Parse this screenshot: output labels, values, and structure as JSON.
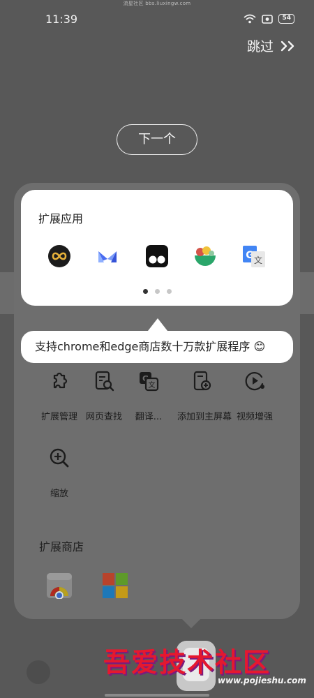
{
  "watermark": {
    "top_text": "流星社区 bbs.liuxingw.com"
  },
  "status_bar": {
    "time": "11:39",
    "battery": "54",
    "icons": [
      "wifi-icon",
      "screen-record-icon",
      "battery-icon"
    ]
  },
  "onboarding": {
    "skip_label": "跳过",
    "skip_icon": "double-chevron-right-icon",
    "next_label": "下一个"
  },
  "card": {
    "title": "扩展应用",
    "apps": [
      {
        "name": "infinity-extension-icon",
        "color": "#c99a1e"
      },
      {
        "name": "m-extension-icon",
        "color": "#5b7cf2"
      },
      {
        "name": "tampermonkey-icon",
        "color": "#111111"
      },
      {
        "name": "food-bowl-extension-icon",
        "color": "#2aa66a"
      },
      {
        "name": "google-translate-icon",
        "color": "#4285f4"
      }
    ],
    "page_dots": {
      "count": 3,
      "active": 0
    }
  },
  "tip": {
    "text": "支持chrome和edge商店数十万款扩展程序 😊"
  },
  "tools": [
    {
      "label": "扩展管理",
      "icon": "puzzle-icon"
    },
    {
      "label": "网页查找",
      "icon": "page-search-icon"
    },
    {
      "label": "翻译...",
      "icon": "translate-icon"
    },
    {
      "label": "添加到主屏幕",
      "icon": "add-to-home-icon"
    },
    {
      "label": "视频增强",
      "icon": "video-enhance-icon"
    },
    {
      "label": "缩放",
      "icon": "zoom-in-icon"
    }
  ],
  "store": {
    "title": "扩展商店",
    "items": [
      "chrome-store-icon",
      "microsoft-store-icon"
    ]
  },
  "brand": {
    "text": "吾爱技术社区",
    "url": "www.pojieshu.com"
  }
}
